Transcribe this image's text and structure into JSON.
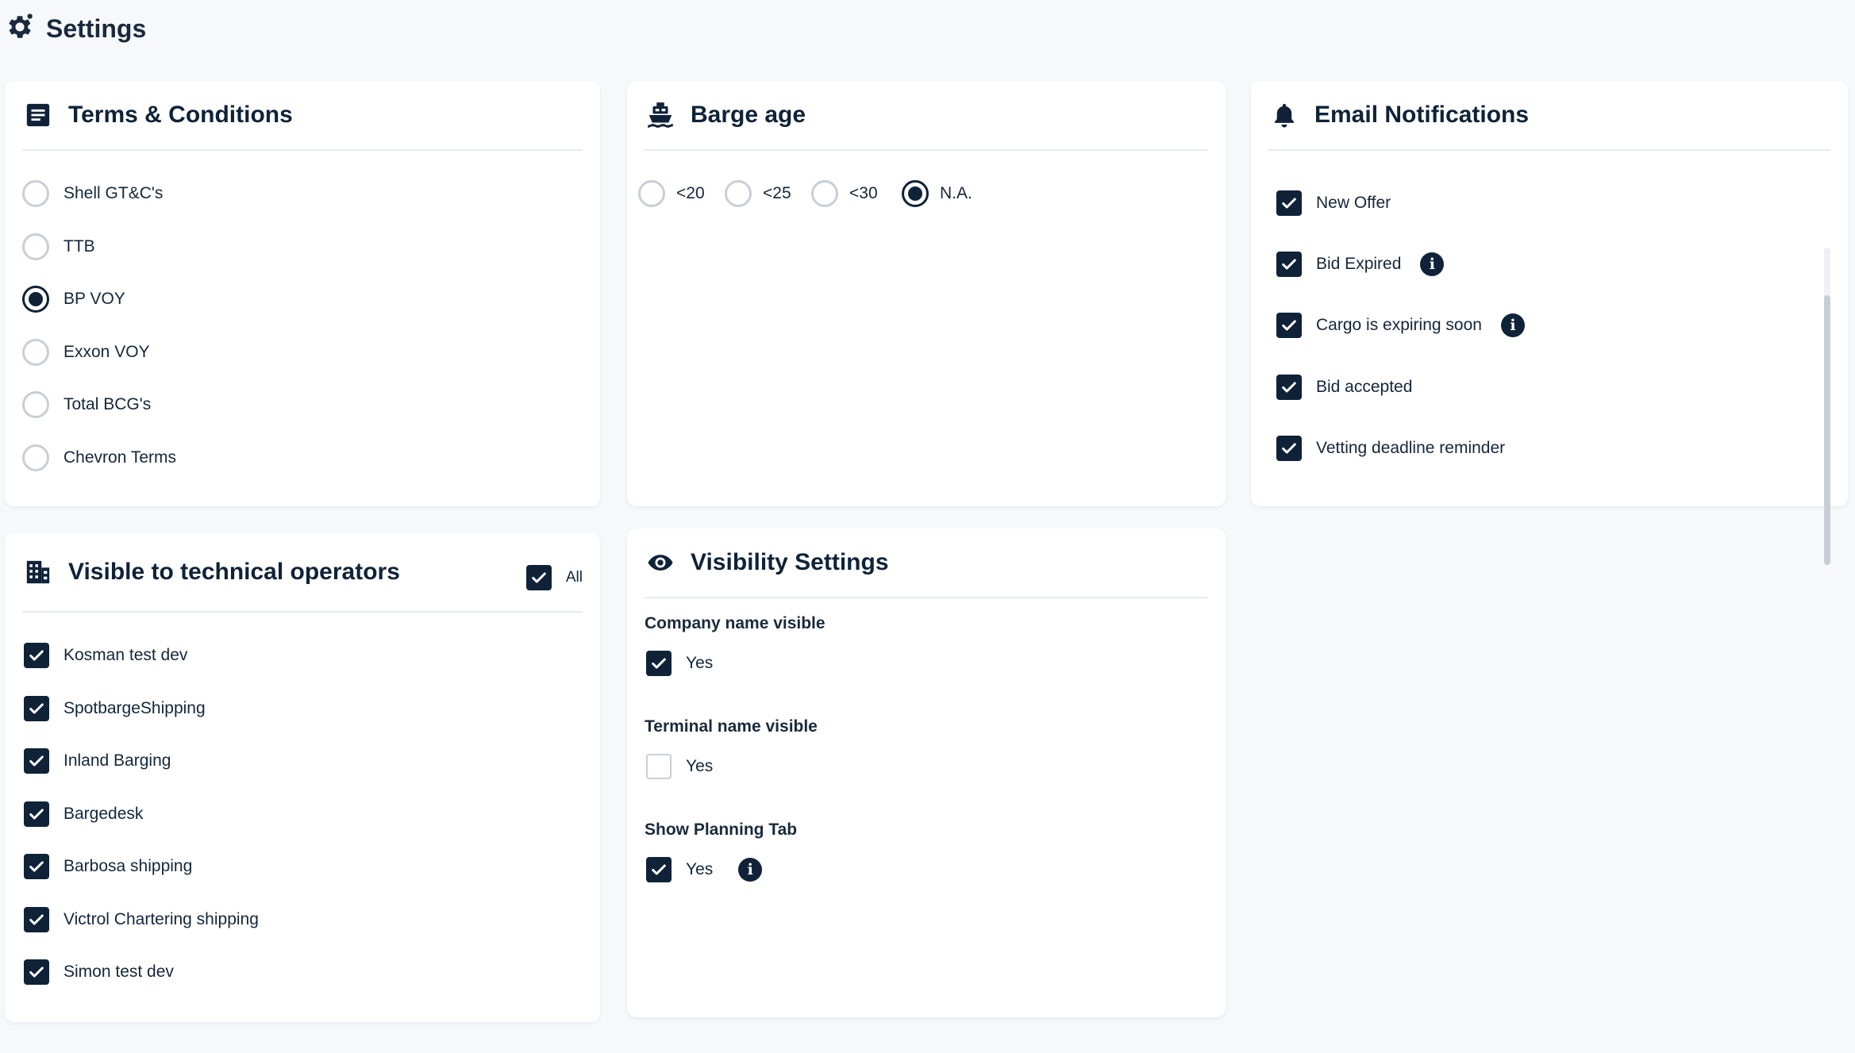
{
  "page": {
    "title": "Settings"
  },
  "colors": {
    "primary": "#0f2238",
    "unchecked_border": "#c8cfd8",
    "divider": "#e7ebf0",
    "background": "#f6f8fb"
  },
  "terms": {
    "title": "Terms & Conditions",
    "icon": "document-icon",
    "options": [
      "Shell GT&C's",
      "TTB",
      "BP VOY",
      "Exxon VOY",
      "Total BCG's",
      "Chevron Terms"
    ],
    "selected": "BP VOY"
  },
  "barge_age": {
    "title": "Barge age",
    "icon": "ship-icon",
    "options": [
      "<20",
      "<25",
      "<30",
      "N.A."
    ],
    "selected": "N.A."
  },
  "email": {
    "title": "Email Notifications",
    "icon": "bell-icon",
    "items": [
      {
        "label": "New Offer",
        "checked": true,
        "info": false
      },
      {
        "label": "Bid Expired",
        "checked": true,
        "info": true
      },
      {
        "label": "Cargo is expiring soon",
        "checked": true,
        "info": true
      },
      {
        "label": "Bid accepted",
        "checked": true,
        "info": false
      },
      {
        "label": "Vetting deadline reminder",
        "checked": true,
        "info": false
      }
    ]
  },
  "operators": {
    "title": "Visible to technical operators",
    "icon": "building-icon",
    "all_label": "All",
    "all_checked": true,
    "items": [
      {
        "label": "Kosman test dev",
        "checked": true
      },
      {
        "label": "SpotbargeShipping",
        "checked": true
      },
      {
        "label": "Inland Barging",
        "checked": true
      },
      {
        "label": "Bargedesk",
        "checked": true
      },
      {
        "label": "Barbosa shipping",
        "checked": true
      },
      {
        "label": "Victrol Chartering shipping",
        "checked": true
      },
      {
        "label": "Simon test dev",
        "checked": true
      }
    ]
  },
  "visibility": {
    "title": "Visibility Settings",
    "icon": "eye-icon",
    "groups": [
      {
        "label": "Company name visible",
        "option": "Yes",
        "checked": true,
        "info": false
      },
      {
        "label": "Terminal name visible",
        "option": "Yes",
        "checked": false,
        "info": false
      },
      {
        "label": "Show Planning Tab",
        "option": "Yes",
        "checked": true,
        "info": true
      }
    ]
  }
}
